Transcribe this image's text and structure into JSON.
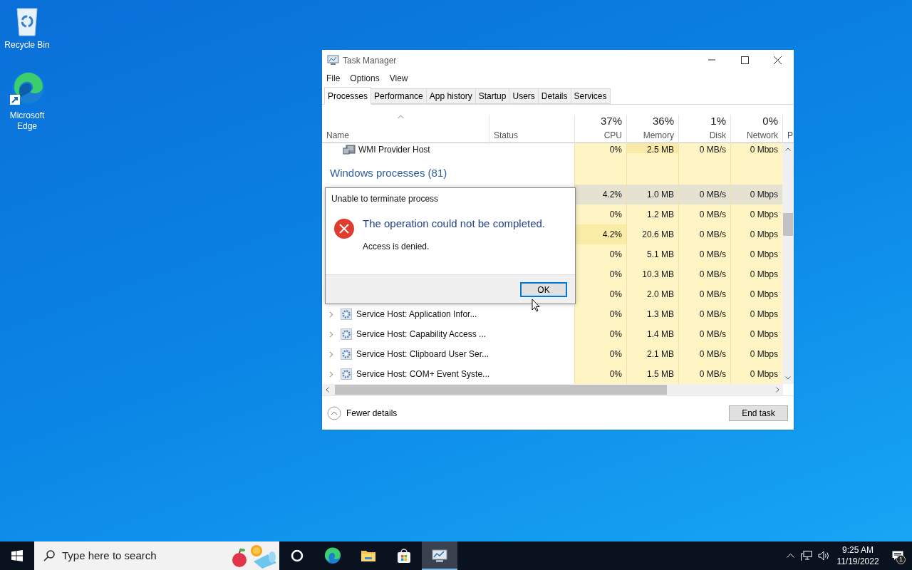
{
  "desktop_icons": [
    {
      "kind": "recycle",
      "label": "Recycle Bin"
    },
    {
      "kind": "edge",
      "label": "Microsoft Edge"
    }
  ],
  "window": {
    "title": "Task Manager"
  },
  "menu": [
    "File",
    "Options",
    "View"
  ],
  "tabs": [
    {
      "label": "Processes",
      "selected": true
    },
    {
      "label": "Performance",
      "selected": false
    },
    {
      "label": "App history",
      "selected": false
    },
    {
      "label": "Startup",
      "selected": false
    },
    {
      "label": "Users",
      "selected": false
    },
    {
      "label": "Details",
      "selected": false
    },
    {
      "label": "Services",
      "selected": false
    }
  ],
  "columns": [
    {
      "label": "Name"
    },
    {
      "label": "Status"
    },
    {
      "percent": "37%",
      "label": "CPU"
    },
    {
      "percent": "36%",
      "label": "Memory"
    },
    {
      "percent": "1%",
      "label": "Disk"
    },
    {
      "percent": "0%",
      "label": "Network"
    },
    {
      "label": "P"
    }
  ],
  "rows": [
    {
      "kind": "process",
      "name": "WMI Provider Host",
      "cpu": "0%",
      "memory": "2.5 MB",
      "disk": "0 MB/s",
      "network": "0 Mbps",
      "selected": false
    },
    {
      "kind": "group",
      "name": "Windows processes (81)"
    },
    {
      "kind": "process",
      "cpu": "4.2%",
      "memory": "1.0 MB",
      "disk": "0 MB/s",
      "network": "0 Mbps",
      "selected": true
    },
    {
      "kind": "process",
      "cpu": "0%",
      "memory": "1.2 MB",
      "disk": "0 MB/s",
      "network": "0 Mbps",
      "selected": false
    },
    {
      "kind": "process",
      "cpu": "4.2%",
      "memory": "20.6 MB",
      "disk": "0 MB/s",
      "network": "0 Mbps",
      "selected": false
    },
    {
      "kind": "process",
      "cpu": "0%",
      "memory": "5.1 MB",
      "disk": "0 MB/s",
      "network": "0 Mbps",
      "selected": false
    },
    {
      "kind": "process",
      "cpu": "0%",
      "memory": "10.3 MB",
      "disk": "0 MB/s",
      "network": "0 Mbps",
      "selected": false
    },
    {
      "kind": "process",
      "cpu": "0%",
      "memory": "2.0 MB",
      "disk": "0 MB/s",
      "network": "0 Mbps",
      "selected": false
    },
    {
      "kind": "service",
      "name": "Service Host: Application Infor...",
      "cpu": "0%",
      "memory": "1.3 MB",
      "disk": "0 MB/s",
      "network": "0 Mbps",
      "selected": false
    },
    {
      "kind": "service",
      "name": "Service Host: Capability Access ...",
      "cpu": "0%",
      "memory": "1.4 MB",
      "disk": "0 MB/s",
      "network": "0 Mbps",
      "selected": false
    },
    {
      "kind": "service",
      "name": "Service Host: Clipboard User Ser...",
      "cpu": "0%",
      "memory": "2.1 MB",
      "disk": "0 MB/s",
      "network": "0 Mbps",
      "selected": false
    },
    {
      "kind": "service",
      "name": "Service Host: COM+ Event Syste...",
      "cpu": "0%",
      "memory": "1.5 MB",
      "disk": "0 MB/s",
      "network": "0 Mbps",
      "selected": false
    }
  ],
  "footer": {
    "toggle": "Fewer details",
    "button": "End task"
  },
  "dialog": {
    "title": "Unable to terminate process",
    "heading": "The operation could not be completed.",
    "message": "Access is denied.",
    "button": "OK"
  },
  "taskbar": {
    "search_placeholder": "Type here to search",
    "apps": [
      {
        "kind": "cortana",
        "active": false
      },
      {
        "kind": "edge",
        "active": false
      },
      {
        "kind": "explorer",
        "active": false
      },
      {
        "kind": "store",
        "active": false
      },
      {
        "kind": "taskmgr",
        "active": true
      }
    ],
    "time": "9:25 AM",
    "date": "11/19/2022",
    "notifications": "1"
  }
}
